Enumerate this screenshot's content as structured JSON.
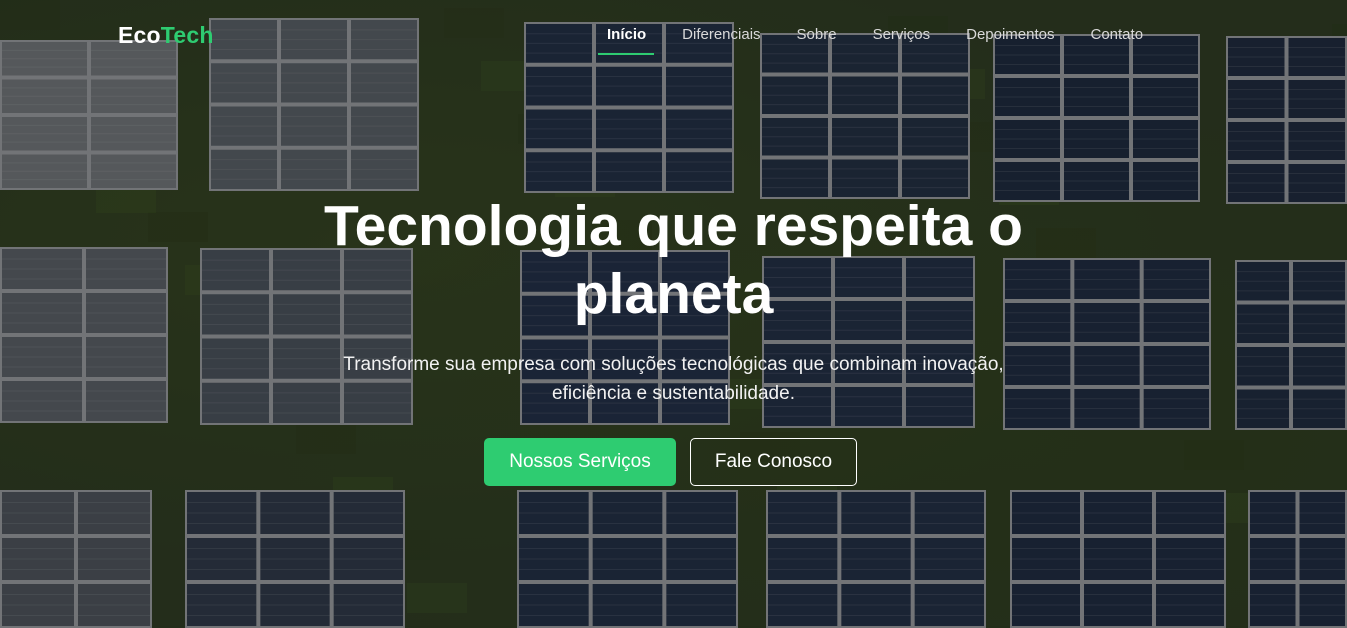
{
  "brand": {
    "part1": "Eco",
    "part2": "Tech",
    "accent_color": "#2ecc71"
  },
  "nav": {
    "items": [
      {
        "label": "Início",
        "active": true
      },
      {
        "label": "Diferenciais",
        "active": false
      },
      {
        "label": "Sobre",
        "active": false
      },
      {
        "label": "Serviços",
        "active": false
      },
      {
        "label": "Depoimentos",
        "active": false
      },
      {
        "label": "Contato",
        "active": false
      }
    ]
  },
  "hero": {
    "headline": "Tecnologia que respeita o planeta",
    "subtitle": "Transforme sua empresa com soluções tecnológicas que combinam inovação, eficiência e sustentabilidade.",
    "primary_button": "Nossos Serviços",
    "secondary_button": "Fale Conosco",
    "background": "aerial view of solar panel arrays on grass"
  }
}
